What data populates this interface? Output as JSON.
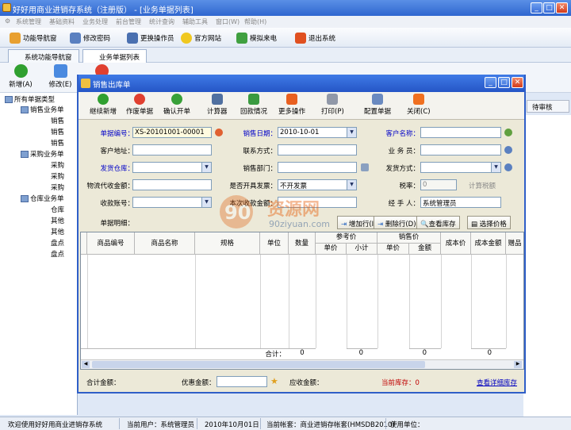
{
  "main_window": {
    "title": "好好用商业进销存系统（注册版） - [业务单据列表]"
  },
  "menu": [
    "系统管理",
    "基础资料",
    "业务处理",
    "前台管理",
    "统计查询",
    "辅助工具",
    "窗口(W)",
    "帮助(H)"
  ],
  "toolbar": [
    "功能导航窗",
    "修改密码",
    "更换操作员",
    "官方网站",
    "模拟来电",
    "退出系统"
  ],
  "tabs": [
    "系统功能导航窗",
    "业务单据列表"
  ],
  "list_toolbar": {
    "new": "新增(A)",
    "edit": "修改(E)"
  },
  "tree": {
    "root": "所有单据类型",
    "nodes": [
      "销售业务单",
      "销售",
      "销售",
      "销售",
      "采购业务单",
      "采购",
      "采购",
      "采购",
      "仓库业务单",
      "仓库",
      "其他",
      "其他",
      "盘点",
      "盘点"
    ]
  },
  "right_button": "待审核",
  "status": {
    "welcome": "欢迎使用好好用商业进销存系统",
    "user": "当前用户：系统管理员",
    "date": "2010年10月01日",
    "account": "当前帐套：商业进销存帐套(HMSDB2010)",
    "unit": "使用单位："
  },
  "dialog": {
    "title": "销售出库单",
    "toolbar": [
      "继续新增",
      "作废单据",
      "确认开单",
      "计算器",
      "回款情况",
      "更多操作",
      "打印(P)",
      "配置单据",
      "关闭(C)"
    ],
    "labels": {
      "doc_no": "单据编号：",
      "sale_date": "销售日期：",
      "customer": "客户名称：",
      "address": "客户地址：",
      "contact": "联系方式：",
      "salesman": "业 务 员：",
      "warehouse": "发货仓库：",
      "dept": "销售部门：",
      "ship_method": "发货方式：",
      "logistics": "物流代收金额：",
      "invoice": "是否开具发票：",
      "tax_rate": "税率：",
      "tax_calc": "计算税额",
      "account_no": "收款账号：",
      "receipt_amount": "本次收款金额：",
      "handler": "经 手 人："
    },
    "values": {
      "doc_no": "XS-20101001-00001",
      "sale_date": "2010-10-01",
      "invoice": "不开发票",
      "tax_rate": "0",
      "handler": "系统管理员"
    },
    "detail_label": "单据明细：",
    "detail_buttons": [
      "增加行(I)",
      "删除行(D)",
      "查看库存",
      "选择价格"
    ],
    "grid_headers": {
      "code": "商品编号",
      "name": "商品名称",
      "spec": "规格",
      "unit": "单位",
      "qty": "数量",
      "ref_price": "参考价",
      "ref_unit": "单价",
      "ref_sub": "小计",
      "sale_price": "销售价",
      "sale_unit": "单价",
      "amount": "金额",
      "cost_price": "成本价",
      "cost_amount": "成本金额",
      "gift": "赠品"
    },
    "totals": {
      "label": "合计：",
      "qty": "0",
      "ref_sub": "0",
      "amount": "0",
      "cost_amount": "0"
    },
    "footer": {
      "total": "合计金额：",
      "discount": "优惠金额：",
      "receivable": "应收金额：",
      "stock": "当前库存：0",
      "detail_link": "查看详细库存"
    }
  },
  "watermark": {
    "text": "资源网",
    "url": "90ziyuan.com"
  }
}
